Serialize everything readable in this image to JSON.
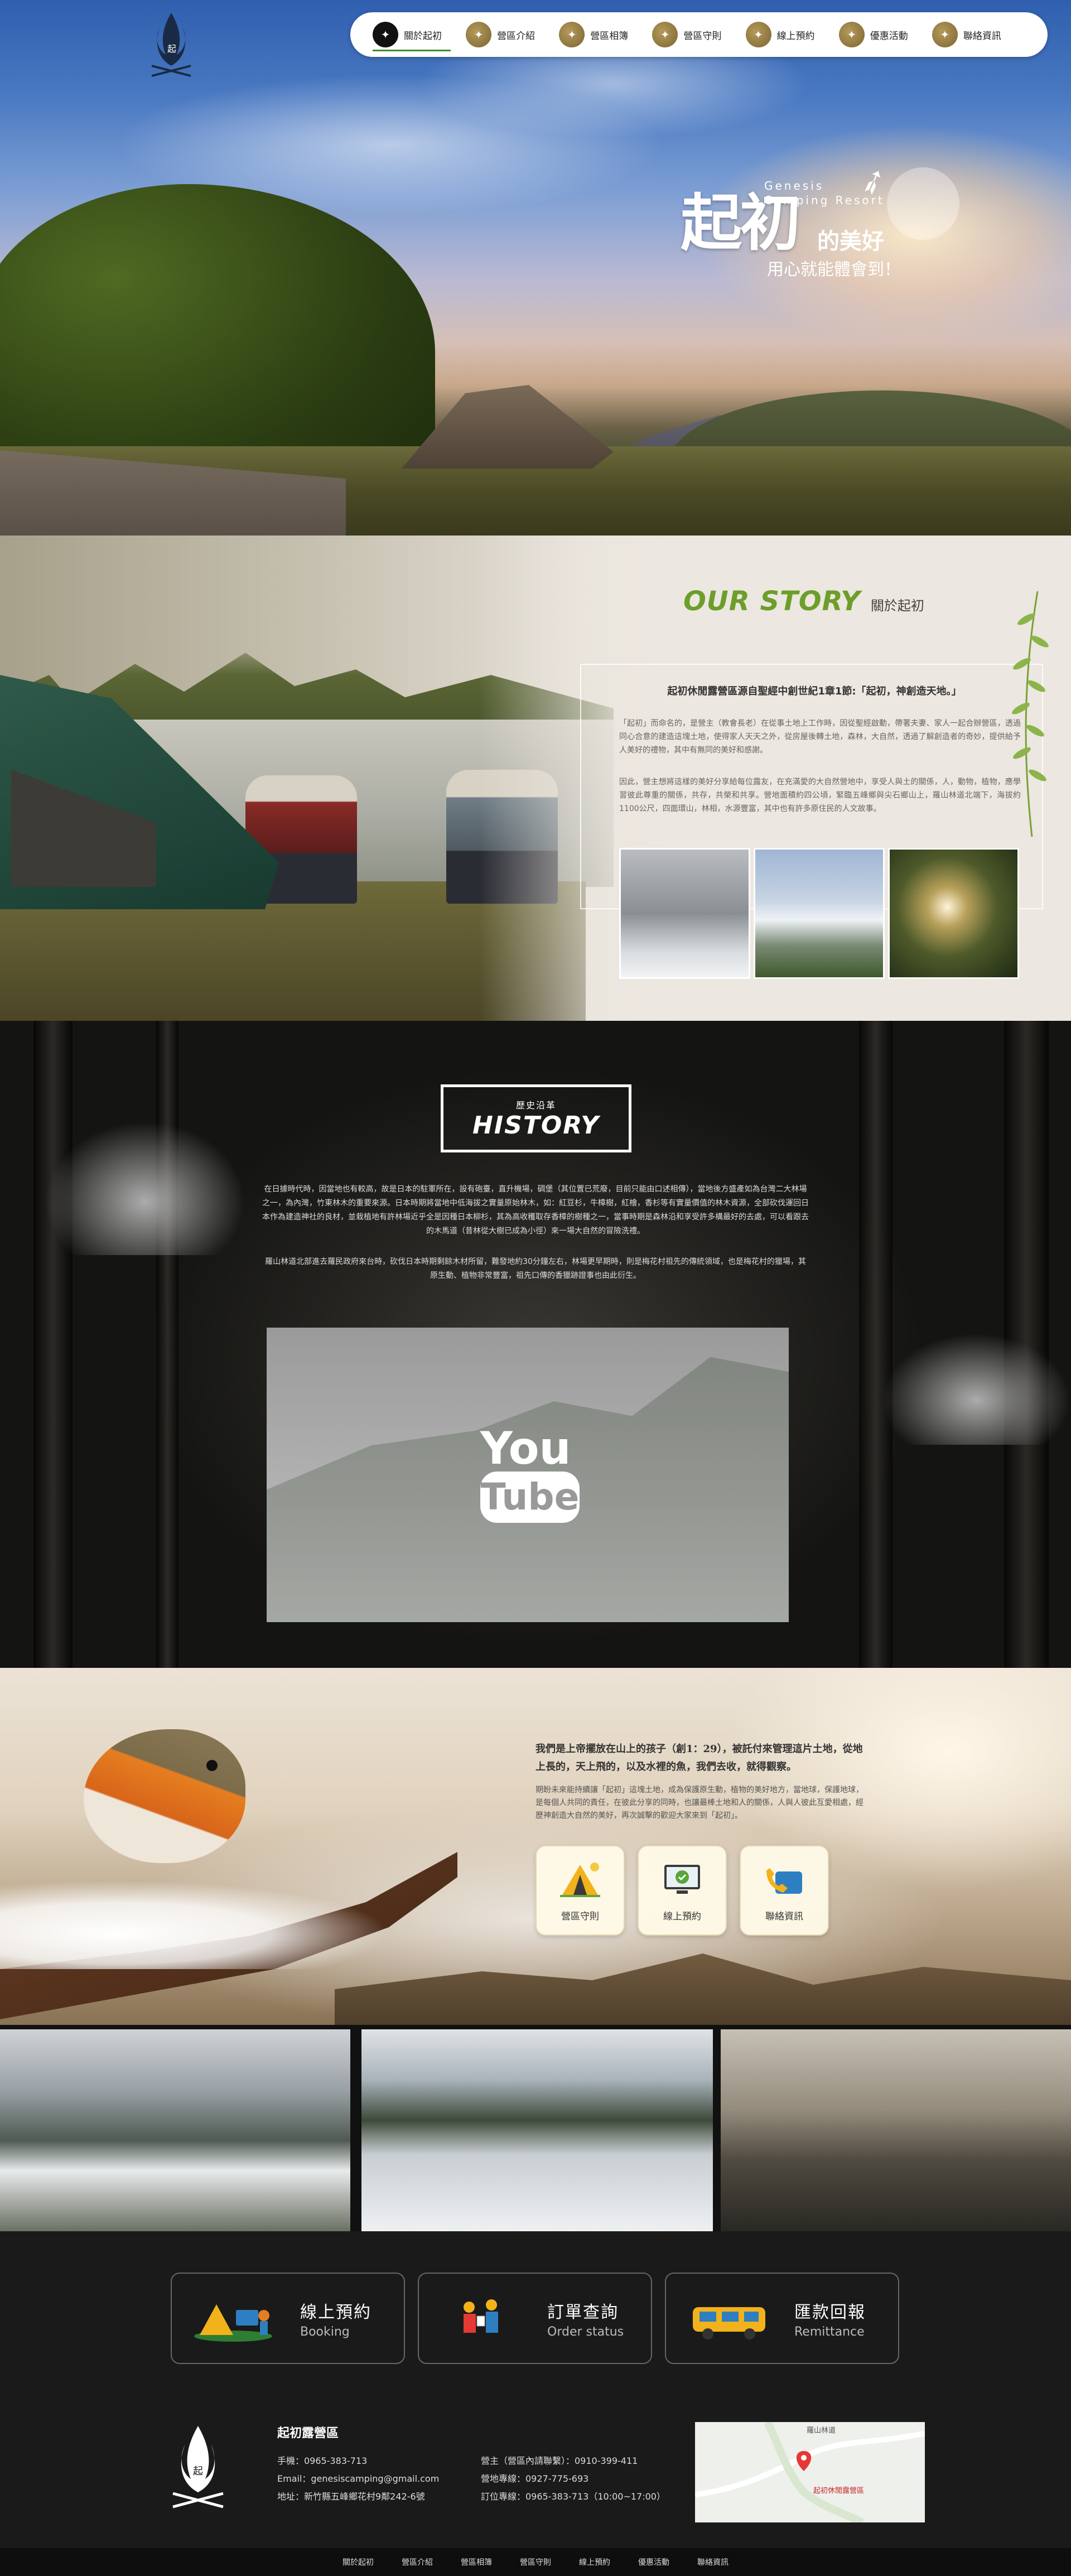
{
  "nav": {
    "items": [
      {
        "label": "關於起初",
        "active": true
      },
      {
        "label": "營區介紹"
      },
      {
        "label": "營區相簿"
      },
      {
        "label": "營區守則"
      },
      {
        "label": "線上預約"
      },
      {
        "label": "優惠活動"
      },
      {
        "label": "聯絡資訊"
      }
    ]
  },
  "hero": {
    "title": "起初",
    "title_en": "Genesis\nCamping Resort",
    "title_de": "的美好",
    "subtitle": "用心就能體會到！"
  },
  "story": {
    "heading": "OUR STORY",
    "heading_zh": "關於起初",
    "lead": "起初休閒露營區源自聖經中創世紀1章1節:「起初，神創造天地。」",
    "p1": "「起初」而命名的，是營主（教會長老）在從事土地上工作時，因從聖經啟動，帶著夫妻、家人一起合辦營區，透過同心合意的建造這塊土地，使得家人天天之外，從房屋後轉土地，森林，大自然，透過了解創造者的奇妙，提供給予人美好的禮物，其中有無同的美好和感謝。",
    "p2": "因此，營主想將這樣的美好分享給每位露友，在充滿愛的大自然營地中，享受人與土的關係，人，動物，植物，應學習彼此尊重的關係，共存，共榮和共享。營地面積約四公頃，緊臨五峰鄉與尖石鄉山上，羅山林道北端下，海拔約1100公尺，四面環山，林相，水源豐富，其中也有許多原住民的人文故事。"
  },
  "history": {
    "label_zh": "歷史沿革",
    "label_en": "HISTORY",
    "p1": "在日據時代時，因當地也有較高，故是日本的駐軍所在，設有砲臺，直升機場，碉堡（其位置已荒廢，目前只能由口述相傳），當地後方盛產如為台灣二大林場之一，為內灣，竹東林木的重要來源。日本時期將當地中低海拔之實量原始林木，如：紅豆杉，牛樟樹，紅檜，香杉等有實量價值的林木資源，全部砍伐運回日本作為建造神社的良材，並栽植地有許林場近乎全是因種日本柳杉，其為高收穫取存香樟的樹種之一，當事時期是森林沿和享受許多構最好的去處，可以看跟去的木馬道（昔林從大樹已成為小徑）來一場大自然的冒險洗禮。",
    "p2": "羅山林道北部進去羅民政府來台時，砍伐日本時期剩餘木材所留，難發地約30分鐘左右，林場更早期時，則是梅花村祖先的傳統領域，也是梅花村的獵場，其原生動、植物非常豐富，祖先口傳的香獵跡證事也由此衍生。",
    "video_you": "You",
    "video_tube": "Tube"
  },
  "robin": {
    "lead": "我們是上帝擺放在山上的孩子（創1：29），被託付來管理這片土地，從地上長的，天上飛的，以及水裡的魚，我們去收，就得觀察。",
    "p": "期盼未來能持續讓「起初」這塊土地，成為保護原生動，植物的美好地方，當地球，保護地球，是每個人共同的責任，在彼此分享的同時，也讓最棒土地和人的關係，人與人彼此互愛相處，經歷神創造大自然的美好，再次誠擊的歡迎大家來到「起初」。",
    "buttons": [
      {
        "label": "營區守則",
        "icon": "tent-rules-icon"
      },
      {
        "label": "線上預約",
        "icon": "monitor-booking-icon"
      },
      {
        "label": "聯絡資訊",
        "icon": "phone-contact-icon"
      }
    ]
  },
  "cta": [
    {
      "zh": "線上預約",
      "en": "Booking",
      "icon": "camping-booking-icon"
    },
    {
      "zh": "訂單查詢",
      "en": "Order status",
      "icon": "order-status-icon"
    },
    {
      "zh": "匯款回報",
      "en": "Remittance",
      "icon": "camper-van-icon"
    }
  ],
  "footer": {
    "name": "起初露營區",
    "phone": "手機：0965-383-713",
    "email": "Email：genesiscamping@gmail.com",
    "address": "地址：新竹縣五峰鄉花村9鄰242-6號",
    "owner": "營主（營區內請聯繫）：0910-399-411",
    "line": "營地專線：0927-775-693",
    "booking": "訂位專線：0965-383-713（10:00~17:00）",
    "map_top": "羅山林道",
    "map_pin": "起初休閒露營區"
  },
  "bottom_links": [
    "關於起初",
    "營區介紹",
    "營區相簿",
    "營區守則",
    "線上預約",
    "優惠活動",
    "聯絡資訊"
  ]
}
